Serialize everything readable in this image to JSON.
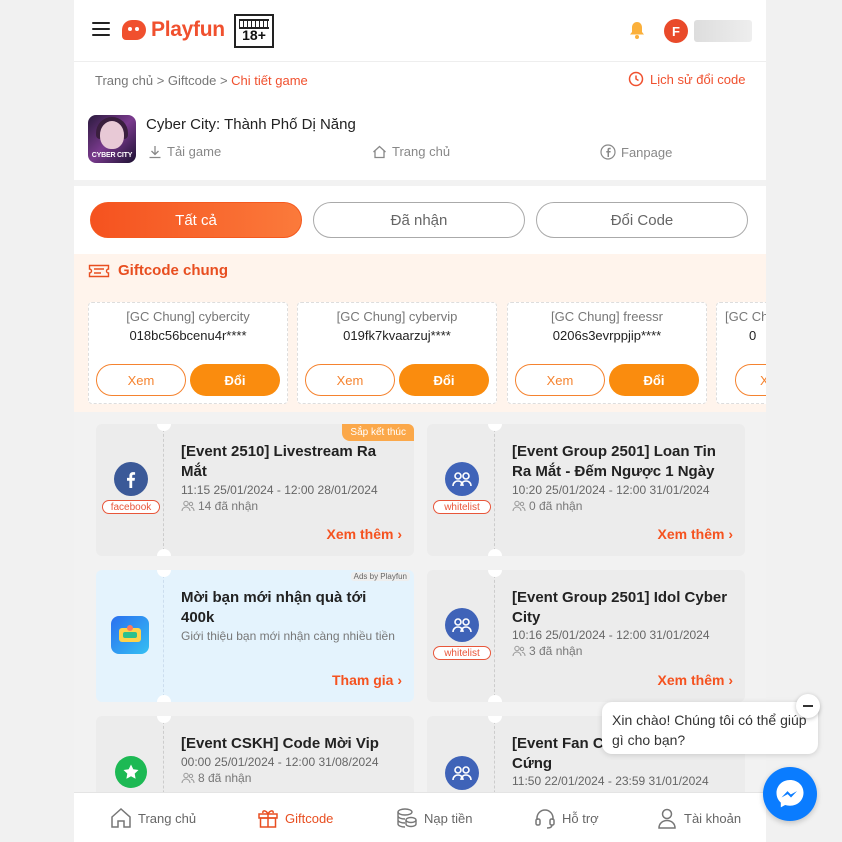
{
  "header": {
    "logo_text": "Playfun",
    "age_rating": "18+",
    "avatar_letter": "F"
  },
  "breadcrumb": {
    "home": "Trang chủ",
    "sep1": ">",
    "giftcode": "Giftcode",
    "sep2": ">",
    "current": "Chi tiết game"
  },
  "history_link": "Lịch sử đổi code",
  "game": {
    "title": "Cyber City: Thành Phố Dị Năng",
    "icon_text": "CYBER CITY",
    "links": [
      "Tải game",
      "Trang chủ",
      "Fanpage"
    ]
  },
  "tabs": [
    "Tất cả",
    "Đã nhận",
    "Đổi Code"
  ],
  "giftcode_section": {
    "title": "Giftcode chung",
    "cards": [
      {
        "name": "[GC Chung] cybercity",
        "code": "018bc56bcenu4r****"
      },
      {
        "name": "[GC Chung] cybervip",
        "code": "019fk7kvaarzuj****"
      },
      {
        "name": "[GC Chung] freessr",
        "code": "0206s3evrppjip****"
      },
      {
        "name": "[GC Chung] cyber",
        "code": "0"
      }
    ],
    "view_label": "Xem",
    "redeem_label": "Đổi",
    "partial_view_label": "Xe"
  },
  "events": [
    {
      "title": "[Event 2510] Livestream Ra Mắt",
      "date": "11:15 25/01/2024 - 12:00 28/01/2024",
      "received": "14 đã nhận",
      "tag": "facebook",
      "badge": "Sắp kết thúc",
      "action": "Xem thêm"
    },
    {
      "title": "[Event Group 2501] Loan Tin Ra Mắt - Đếm Ngược 1 Ngày",
      "date": "10:20 25/01/2024 - 12:00 31/01/2024",
      "received": "0 đã nhận",
      "tag": "whitelist",
      "action": "Xem thêm"
    },
    {
      "title": "Mời bạn mới nhận quà tới 400k",
      "desc": "Giới thiệu bạn mới nhận càng nhiều tiền",
      "ads": "Ads by Playfun",
      "action": "Tham gia"
    },
    {
      "title": "[Event Group 2501] Idol Cyber City",
      "date": "10:16 25/01/2024 - 12:00 31/01/2024",
      "received": "3 đã nhận",
      "tag": "whitelist",
      "action": "Xem thêm"
    },
    {
      "title": "[Event CSKH] Code Mời Vip",
      "date": "00:00 25/01/2024 - 12:00 31/08/2024",
      "received": "8 đã nhận"
    },
    {
      "title": "[Event Fan C… Cứng",
      "title_line1": "[Event Fan C",
      "title_line2": "Cứng",
      "date": "11:50 22/01/2024 - 23:59 31/01/2024"
    }
  ],
  "bottom_nav": [
    "Trang chủ",
    "Giftcode",
    "Nạp tiền",
    "Hỗ trợ",
    "Tài khoản"
  ],
  "chat": {
    "greeting": "Xin chào! Chúng tôi có thể giúp gì cho bạn?"
  },
  "colors": {
    "brand": "#f0502e",
    "accent": "#fa8c0e",
    "messenger": "#0a7cff"
  }
}
